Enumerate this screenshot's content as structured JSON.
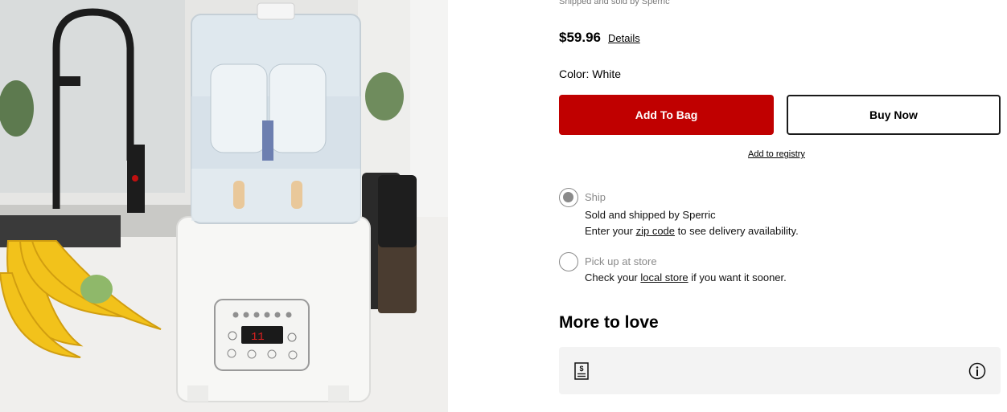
{
  "product": {
    "image_alt": "Bottle sterilizer and warmer on kitchen counter",
    "seller_text": "Shipped and sold by Sperric",
    "price": "$59.96",
    "details_label": "Details",
    "color_label": "Color: White"
  },
  "actions": {
    "add_to_bag": "Add To Bag",
    "buy_now": "Buy Now",
    "add_to_registry": "Add to registry"
  },
  "fulfillment": {
    "ship": {
      "title": "Ship",
      "line1": "Sold and shipped by Sperric",
      "line2_pre": "Enter your ",
      "line2_link": "zip code",
      "line2_post": " to see delivery availability.",
      "selected": true
    },
    "pickup": {
      "title": "Pick up at store",
      "line1_pre": "Check your ",
      "line1_link": "local store",
      "line1_post": " if you want it sooner.",
      "selected": false
    }
  },
  "more_to_love": {
    "title": "More to love",
    "receipt_icon": "receipt-dollar-icon",
    "info_icon": "info-icon"
  },
  "colors": {
    "primary_red": "#c00000",
    "radio_gray": "#8a8a8a",
    "card_bg": "#f3f3f3"
  }
}
